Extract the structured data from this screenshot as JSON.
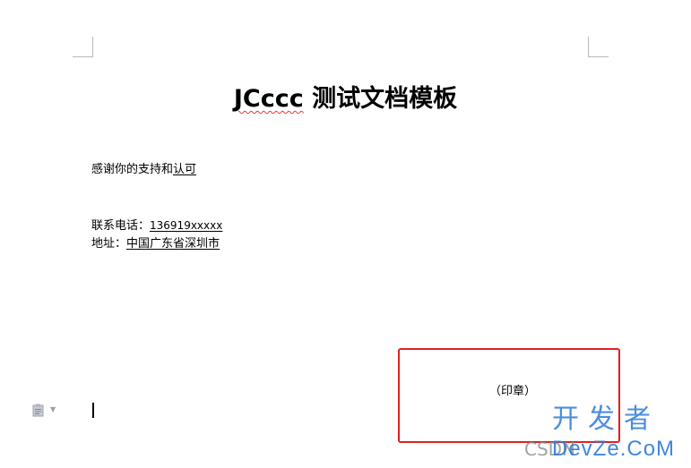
{
  "document": {
    "title_brand": "JCccc",
    "title_rest": " 测试文档模板",
    "thanks_plain": "感谢你的支持和",
    "thanks_underlined": "认可",
    "phone_label": "联系电话：",
    "phone_value": "136919xxxxx",
    "address_label": "地址：",
    "address_value": "中国广东省深圳市",
    "stamp_label": "（印章）"
  },
  "watermark": {
    "cn": "开发者",
    "csdn": "CSDN",
    "brand": "DevZe.CoM"
  },
  "colors": {
    "stamp_border": "#e02020",
    "watermark_blue": "#2b7bd8",
    "spellcheck_wavy": "#e53935"
  },
  "icons": {
    "paste_options": "paste-options-icon"
  }
}
